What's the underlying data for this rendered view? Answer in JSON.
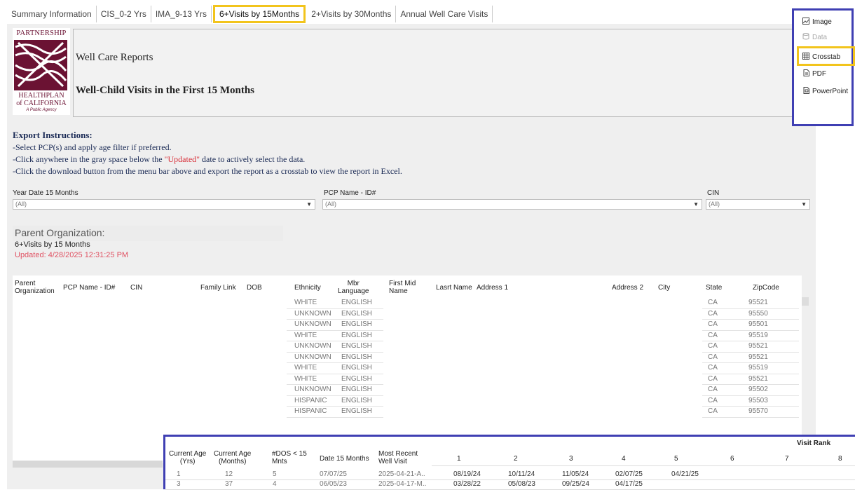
{
  "tabs": [
    {
      "label": "Summary Information",
      "active": false
    },
    {
      "label": "CIS_0-2 Yrs",
      "active": false
    },
    {
      "label": "IMA_9-13 Yrs",
      "active": false
    },
    {
      "label": "6+Visits by 15Months",
      "active": true
    },
    {
      "label": "2+Visits by 30Months",
      "active": false
    },
    {
      "label": "Annual Well Care Visits",
      "active": false
    }
  ],
  "logo": {
    "top": "PARTNERSHIP",
    "bottom1": "HEALTHPLAN",
    "bottom2": "of CALIFORNIA",
    "tagline": "A Public Agency"
  },
  "header": {
    "title": "Well Care Reports",
    "subtitle": "Well-Child Visits in the First 15 Months"
  },
  "instructions": {
    "heading": "Export Instructions:",
    "line1": "-Select PCP(s) and apply age filter if preferred.",
    "line2_a": "-Click anywhere in the gray space below the ",
    "line2_b": "\"Updated\"",
    "line2_c": " date to actively select the data.",
    "line3": "-Click the download button from the menu bar above and export the report as a crosstab to view the report in Excel."
  },
  "filters": {
    "year": {
      "label": "Year Date 15 Months",
      "value": "(All)"
    },
    "pcp": {
      "label": "PCP Name - ID#",
      "value": "(All)"
    },
    "cin": {
      "label": "CIN",
      "value": "(All)"
    }
  },
  "org": {
    "title": "Parent Organization:",
    "subtitle": "6+Visits by 15 Months",
    "updated": "Updated: 4/28/2025 12:31:25 PM"
  },
  "table": {
    "headers": {
      "parent_org_1": "Parent",
      "parent_org_2": "Organization",
      "pcp": "PCP Name - ID#",
      "cin": "CIN",
      "family": "Family Link",
      "dob": "DOB",
      "ethnicity": "Ethnicity",
      "lang_1": "Mbr",
      "lang_2": "Language",
      "first_1": "First Mid",
      "first_2": "Name",
      "last": "Lasrt Name",
      "addr1": "Address 1",
      "addr2": "Address 2",
      "city": "City",
      "state": "State",
      "zip": "ZipCode"
    },
    "rows": [
      {
        "ethnicity": "WHITE",
        "language": "ENGLISH",
        "state": "CA",
        "zip": "95521"
      },
      {
        "ethnicity": "UNKNOWN",
        "language": "ENGLISH",
        "state": "CA",
        "zip": "95550"
      },
      {
        "ethnicity": "UNKNOWN",
        "language": "ENGLISH",
        "state": "CA",
        "zip": "95501"
      },
      {
        "ethnicity": "WHITE",
        "language": "ENGLISH",
        "state": "CA",
        "zip": "95519"
      },
      {
        "ethnicity": "UNKNOWN",
        "language": "ENGLISH",
        "state": "CA",
        "zip": "95521"
      },
      {
        "ethnicity": "UNKNOWN",
        "language": "ENGLISH",
        "state": "CA",
        "zip": "95521"
      },
      {
        "ethnicity": "WHITE",
        "language": "ENGLISH",
        "state": "CA",
        "zip": "95519"
      },
      {
        "ethnicity": "WHITE",
        "language": "ENGLISH",
        "state": "CA",
        "zip": "95521"
      },
      {
        "ethnicity": "UNKNOWN",
        "language": "ENGLISH",
        "state": "CA",
        "zip": "95502"
      },
      {
        "ethnicity": "HISPANIC",
        "language": "ENGLISH",
        "state": "CA",
        "zip": "95503"
      },
      {
        "ethnicity": "HISPANIC",
        "language": "ENGLISH",
        "state": "CA",
        "zip": "95570"
      }
    ]
  },
  "export_menu": {
    "items": [
      {
        "label": "Image",
        "icon": "image-icon",
        "enabled": true
      },
      {
        "label": "Data",
        "icon": "data-icon",
        "enabled": false
      },
      {
        "label": "Crosstab",
        "icon": "crosstab-icon",
        "enabled": true,
        "highlighted": true
      },
      {
        "label": "PDF",
        "icon": "pdf-icon",
        "enabled": true
      },
      {
        "label": "PowerPoint",
        "icon": "powerpoint-icon",
        "enabled": true
      }
    ]
  },
  "visit_rank": {
    "title": "Visit Rank",
    "headers": {
      "age_yrs_1": "Current Age",
      "age_yrs_2": "(Yrs)",
      "age_mos_1": "Current Age",
      "age_mos_2": "(Months)",
      "dos_1": "#DOS < 15",
      "dos_2": "Mnts",
      "date15": "Date 15 Months",
      "recent_1": "Most Recent",
      "recent_2": "Well Visit",
      "ranks": [
        "1",
        "2",
        "3",
        "4",
        "5",
        "6",
        "7",
        "8"
      ]
    },
    "rows": [
      {
        "age_yrs": "1",
        "age_mos": "12",
        "dos": "5",
        "date15": "07/07/25",
        "recent": "2025-04-21-A..",
        "visits": [
          "08/19/24",
          "10/11/24",
          "11/05/24",
          "02/07/25",
          "04/21/25"
        ]
      },
      {
        "age_yrs": "3",
        "age_mos": "37",
        "dos": "4",
        "date15": "06/05/23",
        "recent": "2025-04-17-M..",
        "visits": [
          "03/28/22",
          "05/08/23",
          "09/25/24",
          "04/17/25"
        ]
      }
    ]
  },
  "colors": {
    "accent_highlight": "#f2c41c",
    "overlay_border": "#3f3fb3",
    "brand": "#6b1233",
    "updated_text": "#e05263"
  }
}
